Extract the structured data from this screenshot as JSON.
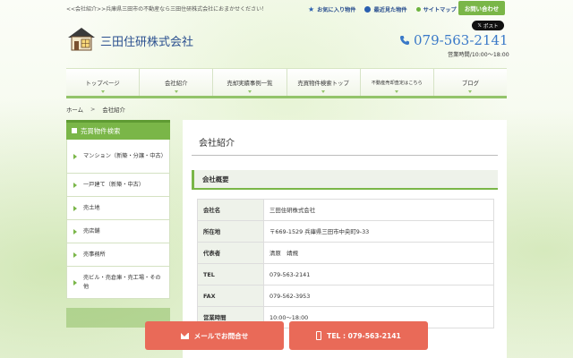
{
  "header": {
    "tagline": "<<会社紹介>>兵庫県三田市の不動産なら三田住研株式会社におまかせください！",
    "links": [
      {
        "label": "お気に入り物件",
        "icon": "star-icon"
      },
      {
        "label": "最近見た物件",
        "icon": "clock-icon"
      },
      {
        "label": "サイトマップ",
        "icon": "dot-icon"
      }
    ],
    "inquiry_button": "お問い合わせ",
    "x_post": "ポスト",
    "company_name": "三田住研株式会社",
    "phone": "079-563-2141",
    "hours": "営業時間/10:00～18:00"
  },
  "nav": {
    "items": [
      "トップページ",
      "会社紹介",
      "売却実績事例一覧",
      "売買物件検索トップ",
      "不動産売却査定はこちら",
      "ブログ"
    ]
  },
  "breadcrumb": {
    "home": "ホーム",
    "sep": ">",
    "current": "会社紹介"
  },
  "sidebar": {
    "heading": "売買物件検索",
    "items": [
      "マンション（新築・分譲・中古）",
      "一戸建て（新築・中古）",
      "売土地",
      "売店舗",
      "売事務所",
      "売ビル・売倉庫・売工場・その他"
    ]
  },
  "main": {
    "title": "会社紹介",
    "section": "会社概要",
    "rows": [
      {
        "key": "会社名",
        "value": "三田住研株式会社"
      },
      {
        "key": "所在地",
        "value": "〒669-1529 兵庫県三田市中央町9-33"
      },
      {
        "key": "代表者",
        "value": "清原　靖規"
      },
      {
        "key": "TEL",
        "value": "079-563-2141"
      },
      {
        "key": "FAX",
        "value": "079-562-3953"
      },
      {
        "key": "営業時間",
        "value": "10:00～18:00"
      }
    ]
  },
  "cta": {
    "mail": "メールでお問合せ",
    "tel": "TEL : 079-563-2141"
  },
  "colors": {
    "accent_green": "#7ab648",
    "brand_blue": "#2a4f8f",
    "cta_red": "#e96a58"
  }
}
